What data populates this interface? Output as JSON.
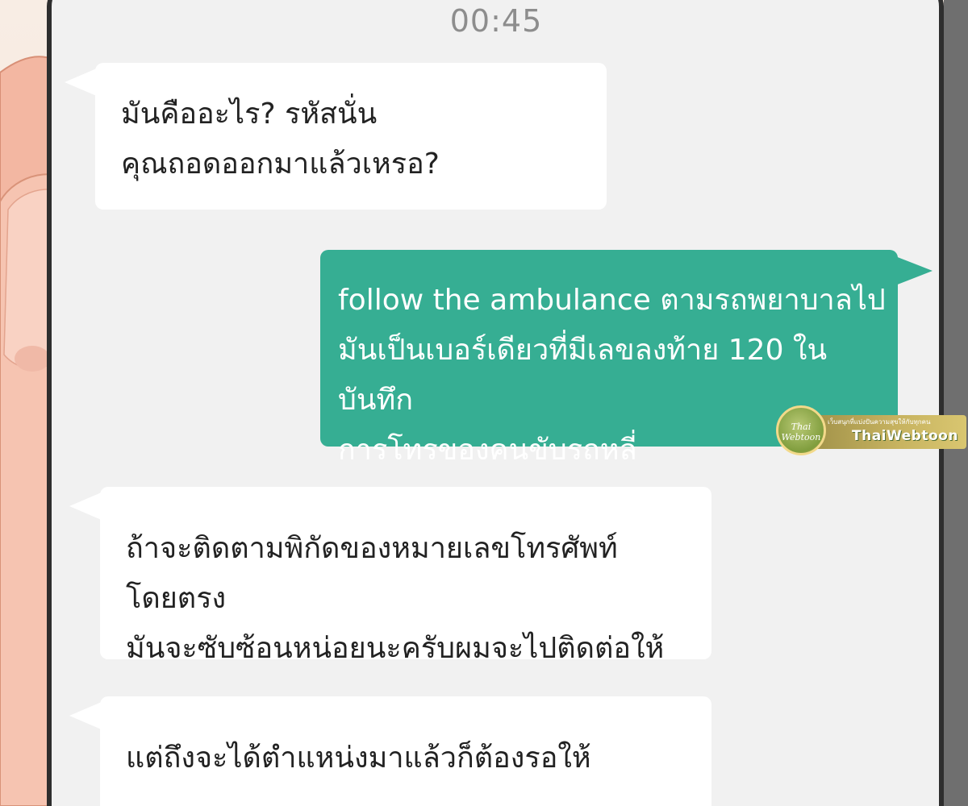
{
  "status_time": "00:45",
  "messages": [
    {
      "direction": "incoming",
      "text": "มันคืออะไร? รหัสนั่น\nคุณถอดออกมาแล้วเหรอ?"
    },
    {
      "direction": "outgoing",
      "text": "follow the ambulance ตามรถพยาบาลไป\nมันเป็นเบอร์เดียวที่มีเลขลงท้าย 120 ในบันทึก\nการโทรของคนขับรถหลี่"
    },
    {
      "direction": "incoming",
      "text": "ถ้าจะติดตามพิกัดของหมายเลขโทรศัพท์โดยตรง\nมันจะซับซ้อนหน่อยนะครับผมจะไปติดต่อให้"
    },
    {
      "direction": "incoming",
      "text": "แต่ถึงจะได้ตำแหน่งมาแล้วก็ต้องรอให้"
    }
  ],
  "watermark": {
    "logo_text": "Thai Webtoon",
    "tagline": "เว็บสนุกที่แบ่งปันความสุขให้กับทุกคน",
    "brand": "ThaiWebtoon"
  },
  "colors": {
    "outgoing_bubble": "#36ae93",
    "incoming_bubble": "#ffffff",
    "chat_background": "#f1f1f1",
    "timestamp": "#8d8d8d"
  }
}
